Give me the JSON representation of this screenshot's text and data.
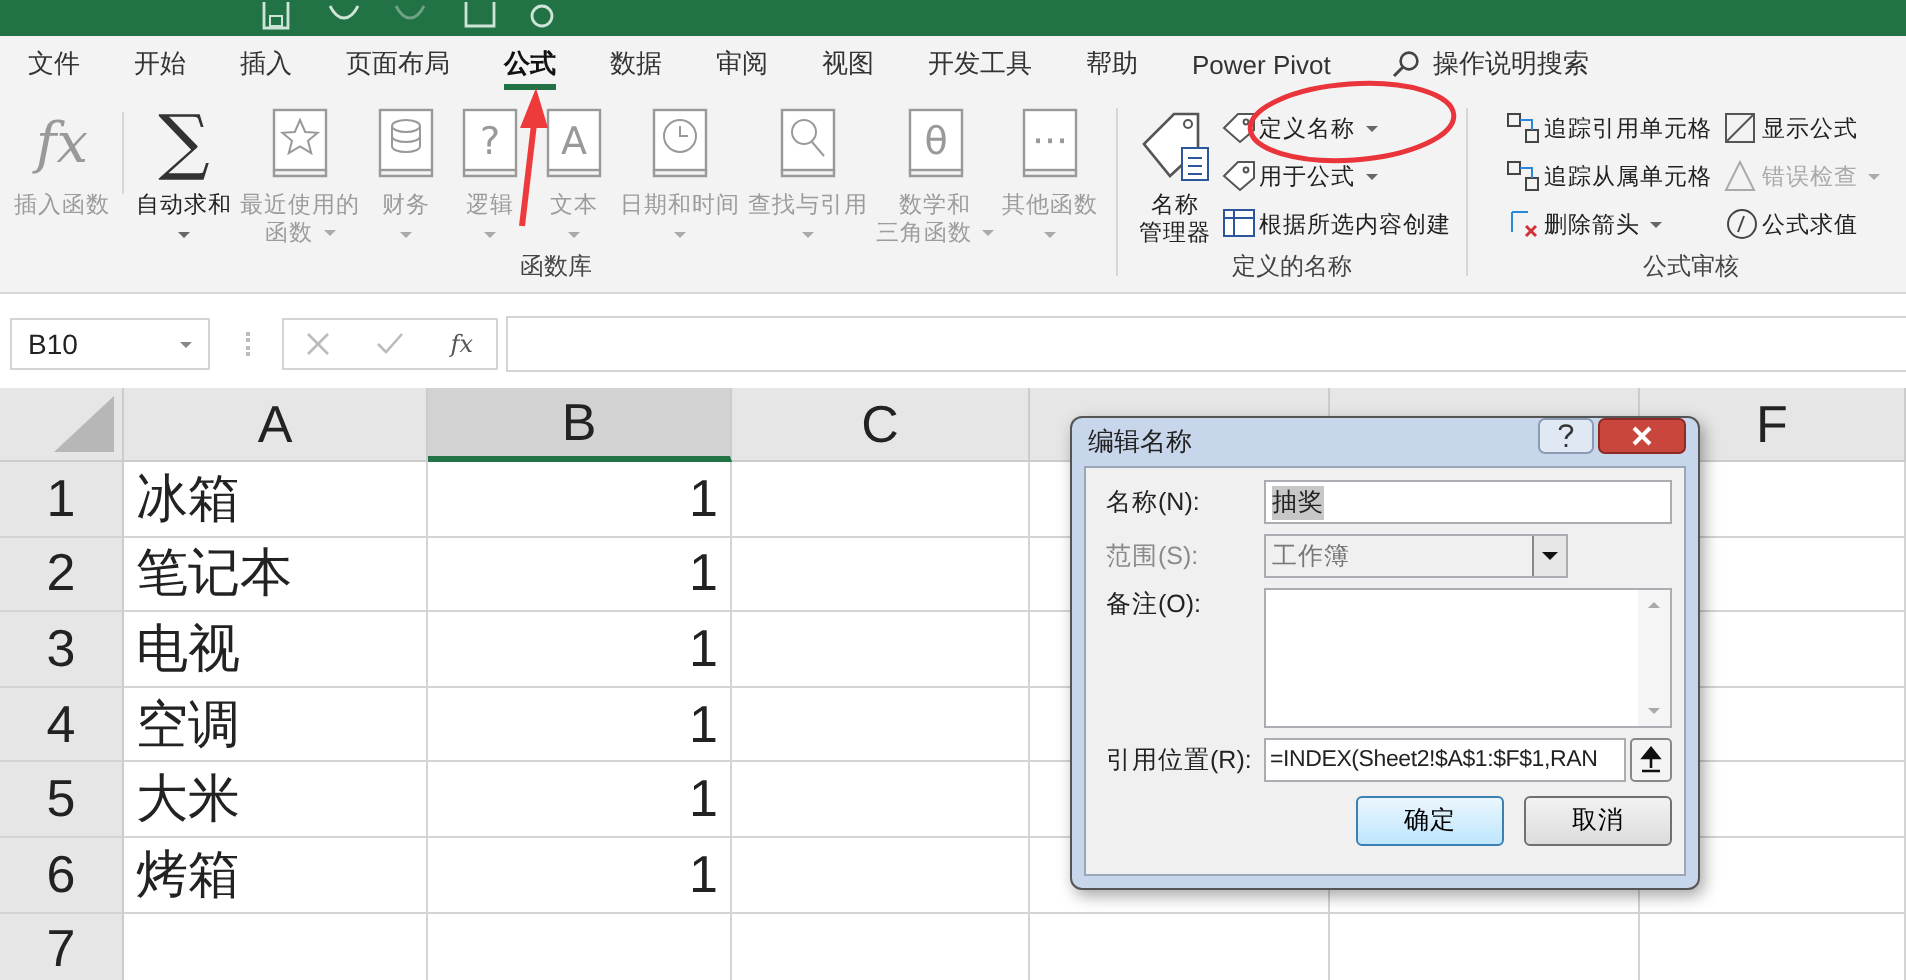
{
  "ribbon_tabs": [
    {
      "label": "文件",
      "selected": false
    },
    {
      "label": "开始",
      "selected": false
    },
    {
      "label": "插入",
      "selected": false
    },
    {
      "label": "页面布局",
      "selected": false
    },
    {
      "label": "公式",
      "selected": true
    },
    {
      "label": "数据",
      "selected": false
    },
    {
      "label": "审阅",
      "selected": false
    },
    {
      "label": "视图",
      "selected": false
    },
    {
      "label": "开发工具",
      "selected": false
    },
    {
      "label": "帮助",
      "selected": false
    },
    {
      "label": "Power Pivot",
      "selected": false
    }
  ],
  "tell_me": "操作说明搜索",
  "ribbon_groups": [
    {
      "label": "函数库",
      "large": [
        {
          "kind": "glyph",
          "glyph": "fx",
          "lines": [
            "插入函数"
          ],
          "disabled": true,
          "dropdown": false
        },
        {
          "kind": "glyph",
          "glyph": "∑",
          "lines": [
            "自动求和"
          ],
          "disabled": false,
          "dropdown": true
        },
        {
          "kind": "book",
          "lines": [
            "最近使用的",
            "函数"
          ],
          "disabled": true,
          "dropdown": true
        },
        {
          "kind": "book",
          "lines": [
            "财务"
          ],
          "disabled": true,
          "dropdown": true
        },
        {
          "kind": "book-glyph",
          "glyph": "?",
          "lines": [
            "逻辑"
          ],
          "disabled": true,
          "dropdown": true
        },
        {
          "kind": "book-glyph",
          "glyph": "A",
          "lines": [
            "文本"
          ],
          "disabled": true,
          "dropdown": true
        },
        {
          "kind": "book",
          "lines": [
            "日期和时间"
          ],
          "disabled": true,
          "dropdown": true
        },
        {
          "kind": "book",
          "lines": [
            "查找与引用"
          ],
          "disabled": true,
          "dropdown": true
        },
        {
          "kind": "book-glyph",
          "glyph": "θ",
          "lines": [
            "数学和",
            "三角函数"
          ],
          "disabled": true,
          "dropdown": true
        },
        {
          "kind": "book-glyph",
          "glyph": "···",
          "lines": [
            "其他函数"
          ],
          "disabled": true,
          "dropdown": true
        }
      ]
    },
    {
      "label": "定义的名称",
      "large": [
        {
          "kind": "tag",
          "lines": [
            "名称",
            "管理器"
          ],
          "disabled": false,
          "dropdown": false
        }
      ],
      "small": [
        {
          "label": "定义名称",
          "disabled": false,
          "dropdown": true
        },
        {
          "label": "用于公式",
          "disabled": false,
          "dropdown": true
        },
        {
          "label": "根据所选内容创建",
          "disabled": false,
          "dropdown": false
        }
      ]
    },
    {
      "label": "公式审核",
      "small": [
        {
          "label": "追踪引用单元格",
          "disabled": false,
          "dropdown": false
        },
        {
          "label": "追踪从属单元格",
          "disabled": false,
          "dropdown": false
        },
        {
          "label": "删除箭头",
          "disabled": false,
          "dropdown": true
        },
        {
          "label": "显示公式",
          "disabled": false,
          "dropdown": false
        },
        {
          "label": "错误检查",
          "disabled": true,
          "dropdown": true
        },
        {
          "label": "公式求值",
          "disabled": false,
          "dropdown": false
        }
      ]
    }
  ],
  "formula_bar": {
    "name_box": "B10",
    "fx": "fx"
  },
  "sheet": {
    "columns": [
      {
        "label": "A",
        "selected": false
      },
      {
        "label": "B",
        "selected": true
      },
      {
        "label": "C",
        "selected": false
      },
      {
        "selected": false
      },
      {
        "selected": false
      },
      {
        "label": "F",
        "selected": false
      }
    ],
    "rows": [
      {
        "number": "1",
        "cells": [
          "冰箱",
          "1"
        ]
      },
      {
        "number": "2",
        "cells": [
          "笔记本",
          "1"
        ]
      },
      {
        "number": "3",
        "cells": [
          "电视",
          "1"
        ]
      },
      {
        "number": "4",
        "cells": [
          "空调",
          "1"
        ]
      },
      {
        "number": "5",
        "cells": [
          "大米",
          "1"
        ]
      },
      {
        "number": "6",
        "cells": [
          "烤箱",
          "1"
        ]
      },
      {
        "number": "7",
        "cells": []
      }
    ]
  },
  "dialog": {
    "title": "编辑名称",
    "name_label": "名称(N):",
    "name_value": "抽奖",
    "name_value_selected": true,
    "scope_label": "范围(S):",
    "scope_value": "工作簿",
    "scope_disabled": true,
    "comment_label": "备注(O):",
    "ref_label": "引用位置(R):",
    "ref_value": "=INDEX(Sheet2!$A$1:$F$1,RAN",
    "buttons": [
      {
        "label": "确定",
        "default": true
      },
      {
        "label": "取消",
        "default": false
      }
    ]
  }
}
